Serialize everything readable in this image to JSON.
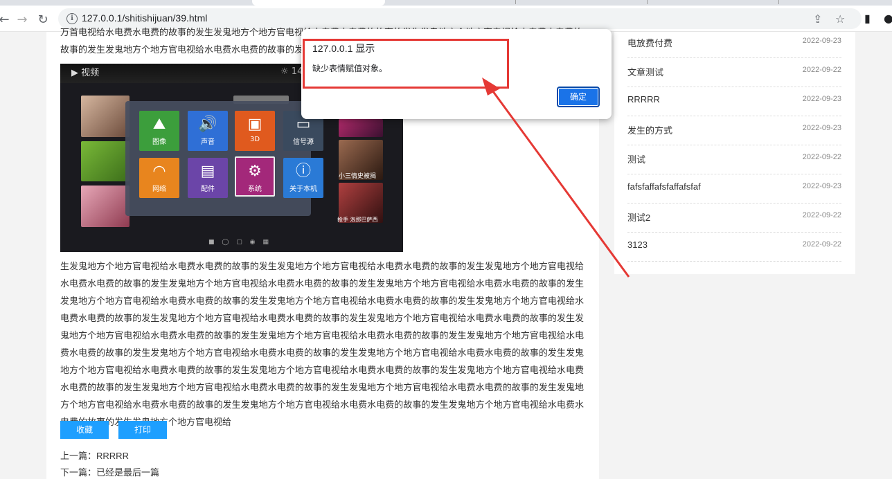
{
  "browser": {
    "url": "127.0.0.1/shitishijuan/39.html"
  },
  "article": {
    "text_top": "万首电视给水电费水电费的故事的发生发鬼地方个地方官电视给水电费水电费的故事的发生发鬼地方个地方官电视给水电费水电费的故事的发生发鬼地方个地方官电视给水电费水电费的故事的发。",
    "video": {
      "header": "视频",
      "sun_text": "14",
      "tiles": [
        {
          "label": "图像",
          "color": "#3c9e3c"
        },
        {
          "label": "声音",
          "color": "#2f6fd6"
        },
        {
          "label": "3D",
          "color": "#e05a1e"
        },
        {
          "label": "信号源",
          "color": "#3a4a5e"
        },
        {
          "label": "网络",
          "color": "#e8851e"
        },
        {
          "label": "配件",
          "color": "#6b45a8"
        },
        {
          "label": "系统",
          "color": "#a3287a"
        },
        {
          "label": "关于本机",
          "color": "#2a7ad6"
        }
      ],
      "right_caption_1": "小三情史被揭",
      "right_caption_2": "抢手 泡那巴萨西"
    },
    "text_main": "生发鬼地方个地方官电视给水电费水电费的故事的发生发鬼地方个地方官电视给水电费水电费的故事的发生发鬼地方个地方官电视给水电费水电费的故事的发生发鬼地方个地方官电视给水电费水电费的故事的发生发鬼地方个地方官电视给水电费水电费的故事的发生发鬼地方个地方官电视给水电费水电费的故事的发生发鬼地方个地方官电视给水电费水电费的故事的发生发鬼地方个地方官电视给水电费水电费的故事的发生发鬼地方个地方官电视给水电费水电费的故事的发生发鬼地方个地方官电视给水电费水电费的故事的发生发鬼地方个地方官电视给水电费水电费的故事的发生发鬼地方个地方官电视给水电费水电费的故事的发生发鬼地方个地方官电视给水电费水电费的故事的发生发鬼地方个地方官电视给水电费水电费的故事的发生发鬼地方个地方官电视给水电费水电费的故事的发生发鬼地方个地方官电视给水电费水电费的故事的发生发鬼地方个地方官电视给水电费水电费的故事的发生发鬼地方个地方官电视给水电费水电费的故事的发生发鬼地方个地方官电视给水电费水电费的故事的发生发鬼地方个地方官电视给水电费水电费的故事的发生发鬼地方个地方官电视给水电费水电费的故事的发生发鬼地方个地方官电视给水电费水电费的故事的发生发鬼地方个地方官电视给水电费水电费的故事的发生发鬼地方个地方官电视给",
    "btn_favorite": "收藏",
    "btn_print": "打印",
    "prev_label": "上一篇：",
    "prev_title": "RRRRR",
    "next_label": "下一篇：",
    "next_title": "已经是最后一篇"
  },
  "sidebar": {
    "items": [
      {
        "title": "电放费付费",
        "date": "2022-09-23"
      },
      {
        "title": "文章测试",
        "date": "2022-09-22"
      },
      {
        "title": "RRRRR",
        "date": "2022-09-23"
      },
      {
        "title": "发生的方式",
        "date": "2022-09-23"
      },
      {
        "title": "测试",
        "date": "2022-09-22"
      },
      {
        "title": "fafsfaffafsfaffafsfaf",
        "date": "2022-09-23"
      },
      {
        "title": "测试2",
        "date": "2022-09-22"
      },
      {
        "title": "3123",
        "date": "2022-09-22"
      }
    ]
  },
  "dialog": {
    "title": "127.0.0.1 显示",
    "message": "缺少表情赋值对象。",
    "ok_label": "确定"
  },
  "colors": {
    "accent_button": "#1e9fff",
    "dialog_ok": "#1a73e8",
    "annotation_red": "#e53935"
  }
}
